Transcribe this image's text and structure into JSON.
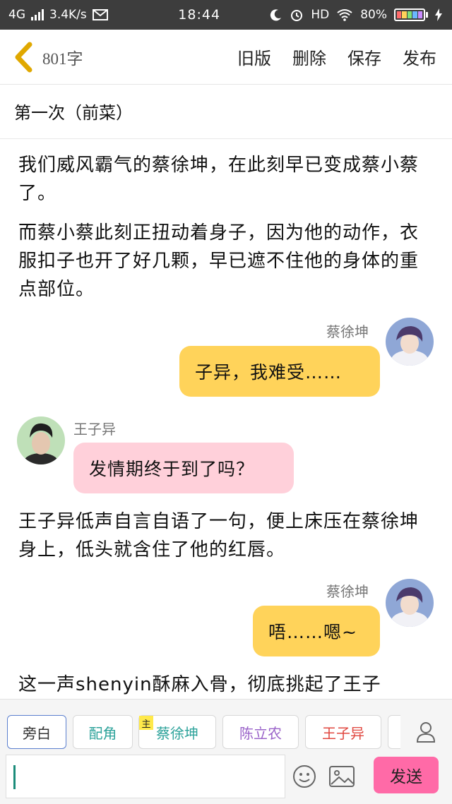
{
  "status_bar": {
    "network": "4G",
    "speed": "3.4K/s",
    "time": "18:44",
    "hd": "HD",
    "battery": "80%"
  },
  "nav": {
    "back_icon": "chevron-left-icon",
    "word_count": "801字",
    "actions": [
      "旧版",
      "删除",
      "保存",
      "发布"
    ]
  },
  "chapter_title": "第一次（前菜）",
  "story": {
    "paragraph_1": "我们威风霸气的蔡徐坤，在此刻早已变成蔡小蔡了。",
    "paragraph_2": "而蔡小蔡此刻正扭动着身子，因为他的动作，衣服扣子也开了好几颗，早已遮不住他的身体的重点部位。",
    "msg_1": {
      "speaker": "蔡徐坤",
      "text": "子异，我难受……"
    },
    "msg_2": {
      "speaker": "王子异",
      "text": "发情期终于到了吗？"
    },
    "paragraph_3": "王子异低声自言自语了一句，便上床压在蔡徐坤身上，低头就含住了他的红唇。",
    "msg_3": {
      "speaker": "蔡徐坤",
      "text": "唔……嗯~"
    },
    "paragraph_4": "这一声shenyin酥麻入骨，彻底挑起了王子"
  },
  "composer": {
    "roles": [
      {
        "label": "旁白",
        "color": "#333333"
      },
      {
        "label": "配角",
        "color": "#2ea39b"
      },
      {
        "label": "蔡徐坤",
        "color": "#2ea39b",
        "badge": "主"
      },
      {
        "label": "陈立农",
        "color": "#9a63c9"
      },
      {
        "label": "王子异",
        "color": "#e0473f"
      }
    ],
    "add_role_icon": "person-icon",
    "emoji_icon": "smiley-icon",
    "image_icon": "image-icon",
    "input_value": "",
    "send_label": "发送"
  },
  "colors": {
    "bubble_yellow": "#ffd35a",
    "bubble_pink": "#ffd0da",
    "send_button": "#ff6aa7",
    "back_arrow": "#e0a800"
  }
}
